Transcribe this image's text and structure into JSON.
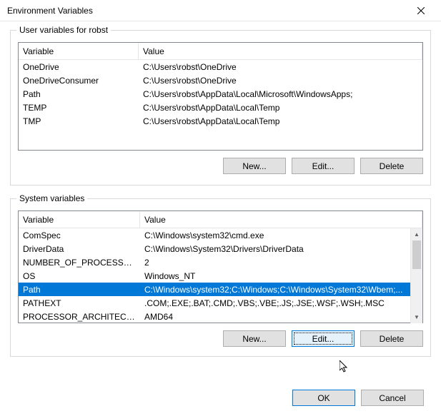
{
  "window": {
    "title": "Environment Variables"
  },
  "userGroup": {
    "label": "User variables for robst",
    "headers": {
      "variable": "Variable",
      "value": "Value"
    },
    "rows": [
      {
        "variable": "OneDrive",
        "value": "C:\\Users\\robst\\OneDrive"
      },
      {
        "variable": "OneDriveConsumer",
        "value": "C:\\Users\\robst\\OneDrive"
      },
      {
        "variable": "Path",
        "value": "C:\\Users\\robst\\AppData\\Local\\Microsoft\\WindowsApps;"
      },
      {
        "variable": "TEMP",
        "value": "C:\\Users\\robst\\AppData\\Local\\Temp"
      },
      {
        "variable": "TMP",
        "value": "C:\\Users\\robst\\AppData\\Local\\Temp"
      }
    ],
    "buttons": {
      "new": "New...",
      "edit": "Edit...",
      "delete": "Delete"
    }
  },
  "systemGroup": {
    "label": "System variables",
    "headers": {
      "variable": "Variable",
      "value": "Value"
    },
    "rows": [
      {
        "variable": "ComSpec",
        "value": "C:\\Windows\\system32\\cmd.exe"
      },
      {
        "variable": "DriverData",
        "value": "C:\\Windows\\System32\\Drivers\\DriverData"
      },
      {
        "variable": "NUMBER_OF_PROCESSORS",
        "value": "2"
      },
      {
        "variable": "OS",
        "value": "Windows_NT"
      },
      {
        "variable": "Path",
        "value": "C:\\Windows\\system32;C:\\Windows;C:\\Windows\\System32\\Wbem;..."
      },
      {
        "variable": "PATHEXT",
        "value": ".COM;.EXE;.BAT;.CMD;.VBS;.VBE;.JS;.JSE;.WSF;.WSH;.MSC"
      },
      {
        "variable": "PROCESSOR_ARCHITECTURE",
        "value": "AMD64"
      }
    ],
    "selectedIndex": 4,
    "buttons": {
      "new": "New...",
      "edit": "Edit...",
      "delete": "Delete"
    }
  },
  "dialogButtons": {
    "ok": "OK",
    "cancel": "Cancel"
  }
}
